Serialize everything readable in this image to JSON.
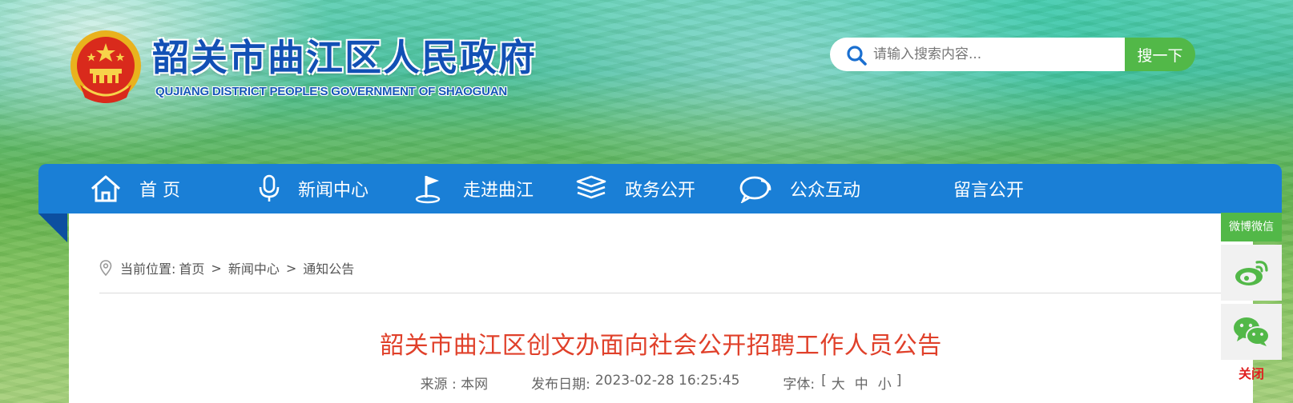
{
  "header": {
    "title": "韶关市曲江区人民政府",
    "subtitle": "QUJIANG DISTRICT PEOPLE'S GOVERNMENT OF SHAOGUAN"
  },
  "search": {
    "placeholder": "请输入搜索内容...",
    "button_label": "搜一下",
    "icon": "search-icon"
  },
  "nav": {
    "items": [
      {
        "label": "首 页",
        "icon": "home-icon"
      },
      {
        "label": "新闻中心",
        "icon": "microphone-icon"
      },
      {
        "label": "走进曲江",
        "icon": "flag-icon"
      },
      {
        "label": "政务公开",
        "icon": "layers-icon"
      },
      {
        "label": "公众互动",
        "icon": "chat-bubbles-icon"
      },
      {
        "label": "留言公开",
        "icon": ""
      }
    ]
  },
  "breadcrumb": {
    "prefix": "当前位置:",
    "items": [
      "首页",
      "新闻中心",
      "通知公告"
    ],
    "separator": ">"
  },
  "article": {
    "title": "韶关市曲江区创文办面向社会公开招聘工作人员公告",
    "source_label": "来源 : 本网",
    "date_label": "发布日期:",
    "date": "2023-02-28 16:25:45",
    "font_label": "字体:",
    "font_open": "[",
    "font_large": "大",
    "font_medium": "中",
    "font_small": "小",
    "font_close": "]"
  },
  "side_float": {
    "header": "微博微信",
    "weibo_icon": "weibo-icon",
    "wechat_icon": "wechat-icon",
    "close_label": "关闭"
  },
  "colors": {
    "nav_bg": "#1a7fd6",
    "accent_green": "#52b848",
    "title_red": "#e0402a",
    "logo_blue": "#1250b5"
  }
}
